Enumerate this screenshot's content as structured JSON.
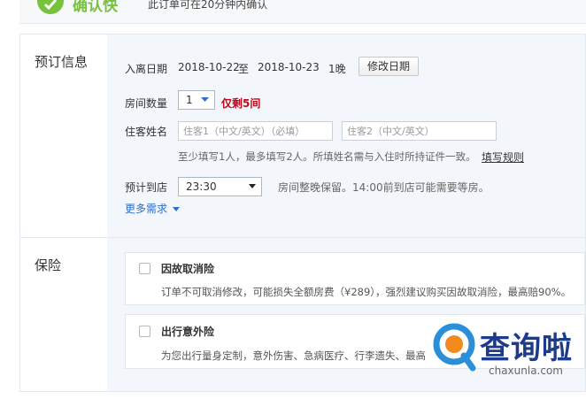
{
  "banner": {
    "title": "确认快",
    "note": "此订单可在20分钟内确认"
  },
  "booking": {
    "section_title": "预订信息",
    "stay_dates": {
      "label": "入离日期",
      "checkin": "2018-10-22",
      "to": "至",
      "checkout": "2018-10-23",
      "nights": "1晚",
      "edit_button": "修改日期"
    },
    "rooms": {
      "label": "房间数量",
      "selected": "1",
      "remaining": "仅剩5间"
    },
    "guests": {
      "label": "住客姓名",
      "guest1_placeholder": "住客1（中文/英文）（必填）",
      "guest2_placeholder": "住客2（中文/英文）",
      "hint": "至少填写1人，最多填写2人。所填姓名需与入住时所持证件一致。",
      "rules_link": "填写规则"
    },
    "arrival": {
      "label": "预计到店",
      "selected": "23:30",
      "note": "房间整晚保留。14:00前到店可能需要等房。"
    },
    "more_link": "更多需求"
  },
  "insurance": {
    "section_title": "保险",
    "items": [
      {
        "title": "因故取消险",
        "desc": "订单不可取消修改，可能损失全额房费（¥289），强烈建议购买因故取消险，最高赔90%。"
      },
      {
        "title": "出行意外险",
        "desc": "为您出行量身定制，意外伤害、急病医疗、行李遗失、最高"
      }
    ]
  },
  "watermark": {
    "name": "查询啦",
    "url": "chaxunla.com"
  },
  "colors": {
    "accent_green": "#77c23c",
    "warning_red": "#c0071b",
    "link_blue": "#2a6fc9",
    "panel_bg": "#f3f6fa"
  }
}
